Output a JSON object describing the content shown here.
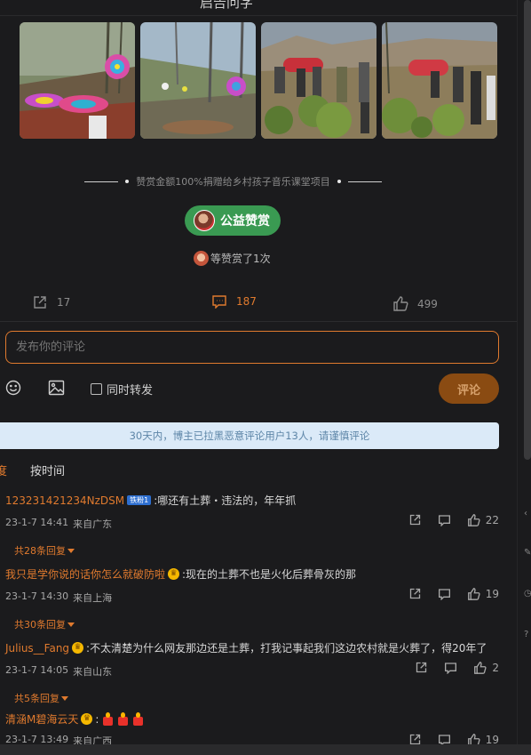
{
  "header": {
    "title": "启告问字"
  },
  "photos": [
    "photo-1",
    "photo-2",
    "photo-3",
    "photo-4"
  ],
  "donation": {
    "text": "赞赏金额100%捐赠给乡村孩子音乐课堂项目"
  },
  "reward": {
    "button_label": "公益赞赏",
    "count_text": "等赞赏了1次"
  },
  "post_actions": {
    "reposts": "17",
    "comments": "187",
    "likes": "499"
  },
  "comment_box": {
    "placeholder": "发布你的评论",
    "repost_label": "同时转发",
    "submit_label": "评论"
  },
  "notice": "30天内，博主已拉黑恶意评论用户13人，请谨慎评论",
  "sort": {
    "hot": "度",
    "time": "按时间"
  },
  "comments": [
    {
      "user": "123231421234NzDSM",
      "badge": "铁粉1",
      "text": ":哪还有土葬・违法的，年年抓",
      "time": "23-1-7 14:41",
      "location": "来自广东",
      "likes": "22",
      "replies": "共28条回复"
    },
    {
      "user": "我只是学你说的话你怎么就破防啦",
      "text": ":现在的土葬不也是火化后葬骨灰的那",
      "time": "23-1-7 14:30",
      "location": "来自上海",
      "likes": "19",
      "replies": "共30条回复"
    },
    {
      "user": "Julius__Fang",
      "text": ":不太清楚为什么网友那边还是土葬，打我记事起我们这边农村就是火葬了，得20年了",
      "time": "23-1-7 14:05",
      "location": "来自山东",
      "likes": "2",
      "replies": "共5条回复"
    },
    {
      "user": "清涵M碧海云天",
      "text": ":",
      "time": "23-1-7 13:49",
      "location": "来自广西",
      "likes": "19"
    }
  ],
  "colors": {
    "accent": "#e07a2e",
    "background": "#1b1b1d",
    "green": "#3a9a52"
  }
}
